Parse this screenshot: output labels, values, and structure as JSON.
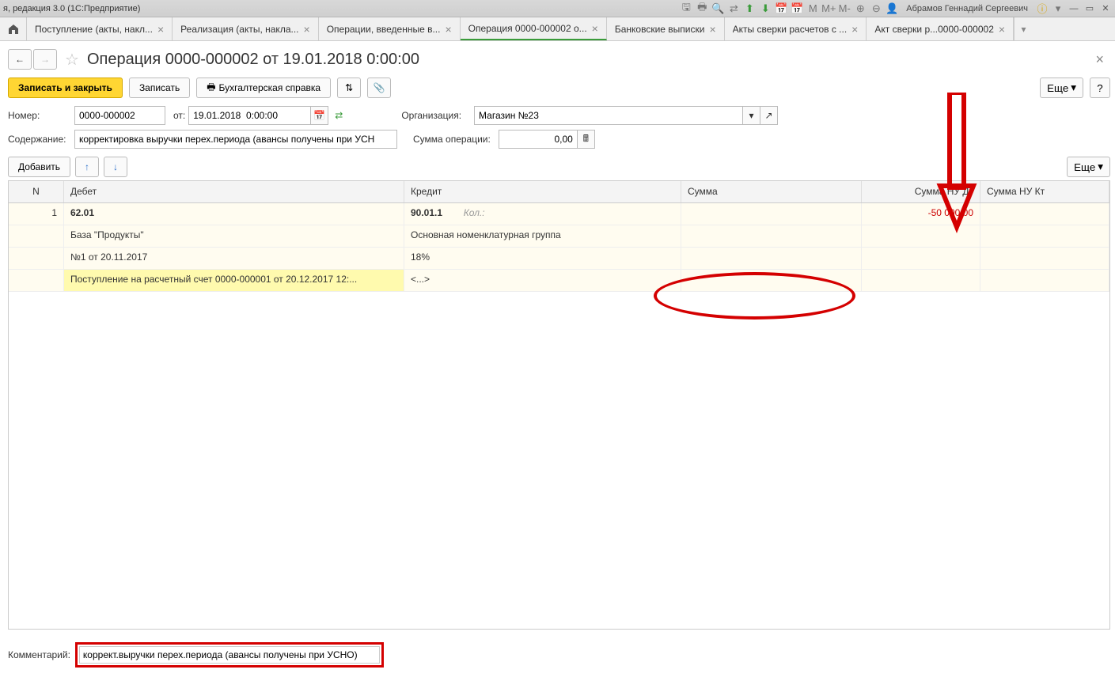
{
  "titlebar": {
    "text": "я, редакция 3.0 (1С:Предприятие)",
    "user": "Абрамов Геннадий Сергеевич"
  },
  "tabs": [
    {
      "label": "Поступление (акты, накл..."
    },
    {
      "label": "Реализация (акты, накла..."
    },
    {
      "label": "Операции, введенные в..."
    },
    {
      "label": "Операция 0000-000002 о...",
      "active": true
    },
    {
      "label": "Банковские выписки"
    },
    {
      "label": "Акты сверки расчетов с ..."
    },
    {
      "label": "Акт сверки р...0000-000002"
    }
  ],
  "page": {
    "title": "Операция 0000-000002 от 19.01.2018 0:00:00"
  },
  "toolbar": {
    "save_close": "Записать и закрыть",
    "save": "Записать",
    "report": "Бухгалтерская справка",
    "more": "Еще"
  },
  "form": {
    "number_lbl": "Номер:",
    "number": "0000-000002",
    "date_lbl": "от:",
    "date": "19.01.2018  0:00:00",
    "org_lbl": "Организация:",
    "org": "Магазин №23",
    "content_lbl": "Содержание:",
    "content": "корректировка выручки перех.периода (авансы получены при УСН",
    "sum_lbl": "Сумма операции:",
    "sum": "0,00"
  },
  "list_toolbar": {
    "add": "Добавить",
    "more": "Еще"
  },
  "columns": {
    "n": "N",
    "debit": "Дебет",
    "credit": "Кредит",
    "sum": "Сумма",
    "nudt": "Сумма НУ Дт",
    "nukt": "Сумма НУ Кт"
  },
  "rows": [
    {
      "n": "1",
      "debit": "62.01",
      "credit": "90.01.1",
      "credit_extra": "Кол.:",
      "nudt": "-50 000,00"
    },
    {
      "debit": "База \"Продукты\"",
      "credit": "Основная номенклатурная группа"
    },
    {
      "debit": "№1 от 20.11.2017",
      "credit": "18%"
    },
    {
      "debit": "Поступление на расчетный счет 0000-000001 от 20.12.2017 12:...",
      "credit": "<...>",
      "sel": true
    }
  ],
  "comment": {
    "lbl": "Комментарий:",
    "value": "коррект.выручки перех.периода (авансы получены при УСНО)"
  }
}
